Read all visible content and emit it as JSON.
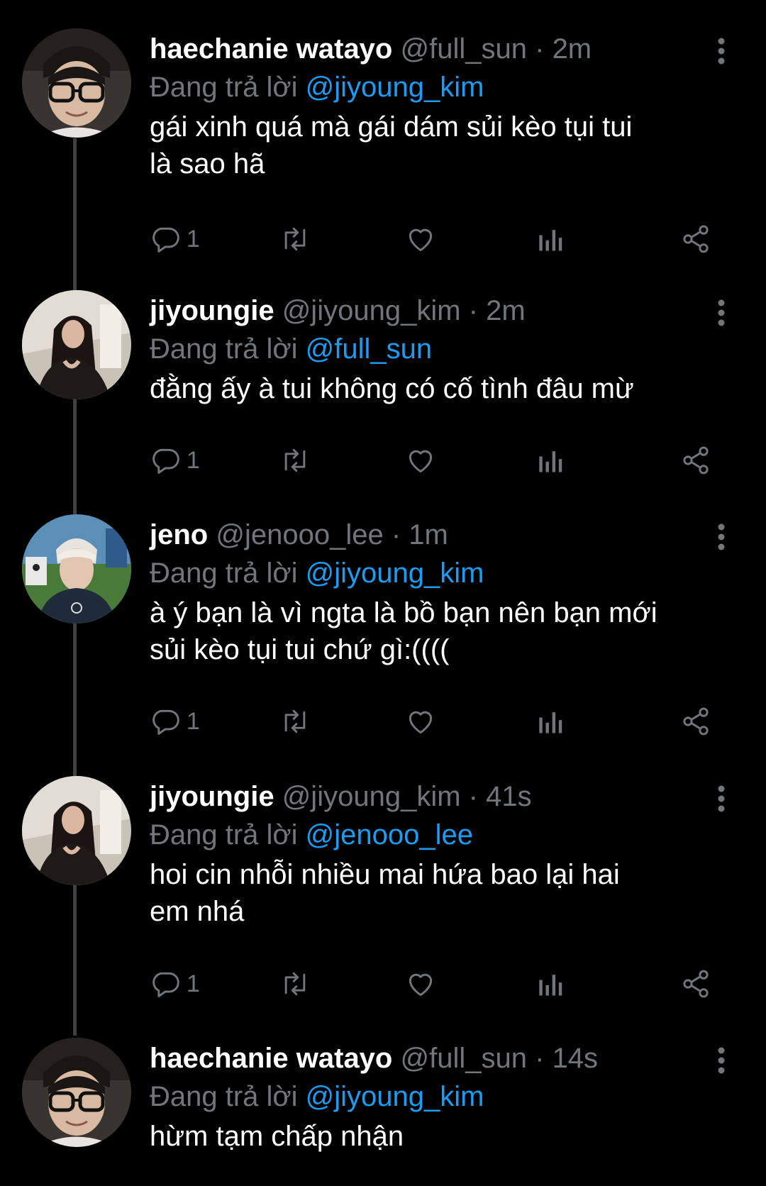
{
  "replying_prefix": "Đang trả lời",
  "tweets": [
    {
      "name": "haechanie watayo",
      "handle": "@full_sun",
      "time": "2m",
      "reply_to": "@jiyoung_kim",
      "text": "gái xinh quá mà gái dám sủi kèo tụi tui\nlà sao hã",
      "reply_count": "1",
      "avatar": "avatar-haechan"
    },
    {
      "name": "jiyoungie",
      "handle": "@jiyoung_kim",
      "time": "2m",
      "reply_to": "@full_sun",
      "text": "đằng ấy à tui không có cố tình đâu mừ",
      "reply_count": "1",
      "avatar": "avatar-jiyoung"
    },
    {
      "name": "jeno",
      "handle": "@jenooo_lee",
      "time": "1m",
      "reply_to": "@jiyoung_kim",
      "text": "à ý bạn là vì ngta là bồ bạn nên bạn mới\nsủi kèo tụi tui chứ gì:((((",
      "reply_count": "1",
      "avatar": "avatar-jeno"
    },
    {
      "name": "jiyoungie",
      "handle": "@jiyoung_kim",
      "time": "41s",
      "reply_to": "@jenooo_lee",
      "text": "hoi cin nhỗi nhiều mai hứa bao lại hai\nem nhá",
      "reply_count": "1",
      "avatar": "avatar-jiyoung"
    },
    {
      "name": "haechanie watayo",
      "handle": "@full_sun",
      "time": "14s",
      "reply_to": "@jiyoung_kim",
      "text": "hừm tạm chấp nhận",
      "reply_count": "",
      "avatar": "avatar-haechan"
    }
  ],
  "icons": {
    "reply": "reply-icon",
    "retweet": "retweet-icon",
    "like": "heart-icon",
    "views": "analytics-icon",
    "share": "share-icon",
    "more": "more-vertical-icon"
  },
  "colors": {
    "background": "#000000",
    "text": "#ffffff",
    "secondary": "#71767b",
    "link": "#1d9bf0",
    "thread_line": "#3e4144"
  }
}
